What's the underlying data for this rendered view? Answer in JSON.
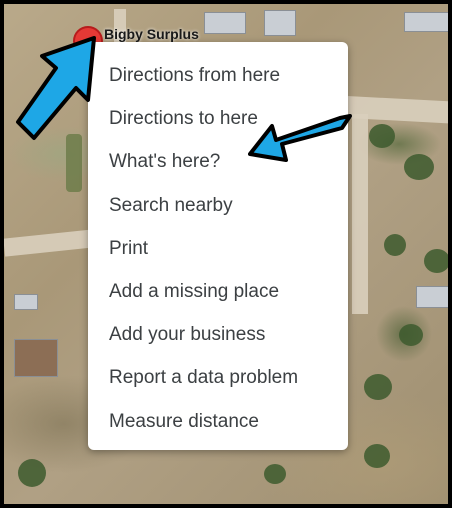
{
  "map": {
    "place_label": "Bigby Surplus"
  },
  "context_menu": {
    "items": [
      {
        "label": "Directions from here"
      },
      {
        "label": "Directions to here"
      },
      {
        "label": "What's here?"
      },
      {
        "label": "Search nearby"
      },
      {
        "label": "Print"
      },
      {
        "label": "Add a missing place"
      },
      {
        "label": "Add your business"
      },
      {
        "label": "Report a data problem"
      },
      {
        "label": "Measure distance"
      }
    ]
  },
  "annotation_colors": {
    "arrow_fill": "#1ea7e6",
    "arrow_outline": "#000000",
    "pin": "#e53935"
  }
}
